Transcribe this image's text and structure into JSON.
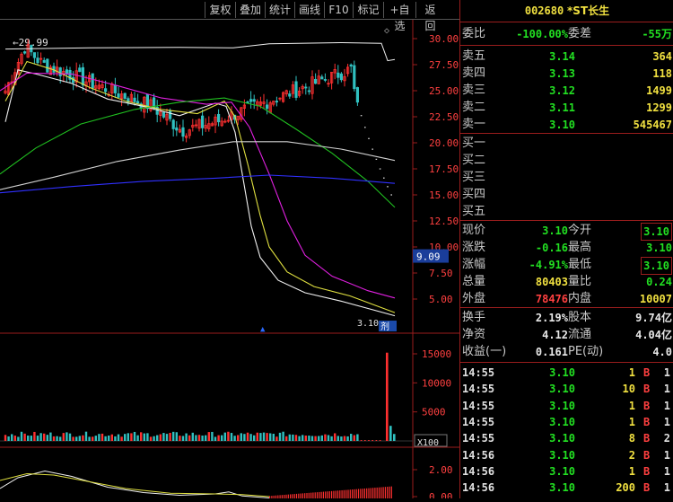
{
  "toolbar": {
    "buttons": [
      "复权",
      "叠加",
      "统计",
      "画线",
      "F10",
      "标记",
      "+自选",
      "返回"
    ]
  },
  "chart": {
    "max_label": "29.99",
    "price_axis": [
      "30.00",
      "27.50",
      "25.00",
      "22.50",
      "20.00",
      "17.50",
      "15.00",
      "12.50",
      "10.00",
      "7.50",
      "5.00"
    ],
    "current_tag": "9.09",
    "last_label": "3.10",
    "last_suffix": "剂",
    "volume_axis": [
      "15000",
      "10000",
      "5000"
    ],
    "volume_unit": "X100",
    "ind_axis": [
      "2.00",
      "0.00"
    ],
    "colors": {
      "up": "#ff3030",
      "down": "#30c0c0",
      "ma5": "#f0f0f0",
      "ma10": "#e0e040",
      "ma20": "#e020e0",
      "ma60": "#20c020",
      "ma120": "#d0d0d0",
      "ma250": "#3030ff",
      "axis": "#9a1d1d",
      "label": "#ff4040"
    }
  },
  "panel": {
    "code": "002680",
    "name": "*ST长生",
    "weibi_label": "委比",
    "weibi_value": "-100.00%",
    "weicha_label": "委差",
    "weicha_value": "-55万",
    "sells": [
      {
        "label": "卖五",
        "price": "3.14",
        "vol": "364"
      },
      {
        "label": "卖四",
        "price": "3.13",
        "vol": "118"
      },
      {
        "label": "卖三",
        "price": "3.12",
        "vol": "1499"
      },
      {
        "label": "卖二",
        "price": "3.11",
        "vol": "1299"
      },
      {
        "label": "卖一",
        "price": "3.10",
        "vol": "545467"
      }
    ],
    "buys": [
      "买一",
      "买二",
      "买三",
      "买四",
      "买五"
    ],
    "quote": [
      {
        "l1": "现价",
        "v1": "3.10",
        "l2": "今开",
        "v2": "3.10"
      },
      {
        "l1": "涨跌",
        "v1": "-0.16",
        "l2": "最高",
        "v2": "3.10"
      },
      {
        "l1": "涨幅",
        "v1": "-4.91%",
        "l2": "最低",
        "v2": "3.10"
      },
      {
        "l1": "总量",
        "v1": "80403",
        "l2": "量比",
        "v2": "0.24"
      },
      {
        "l1": "外盘",
        "v1": "78476",
        "l2": "内盘",
        "v2": "10007"
      }
    ],
    "fund": [
      {
        "l1": "换手",
        "v1": "2.19%",
        "l2": "股本",
        "v2": "9.74亿"
      },
      {
        "l1": "净资",
        "v1": "4.12",
        "l2": "流通",
        "v2": "4.04亿"
      },
      {
        "l1": "收益(一)",
        "v1": "0.161",
        "l2": "PE(动)",
        "v2": "4.0"
      }
    ],
    "ticks": [
      {
        "time": "14:55",
        "price": "3.10",
        "vol": "1",
        "bs": "B",
        "n": "1"
      },
      {
        "time": "14:55",
        "price": "3.10",
        "vol": "10",
        "bs": "B",
        "n": "1"
      },
      {
        "time": "14:55",
        "price": "3.10",
        "vol": "1",
        "bs": "B",
        "n": "1"
      },
      {
        "time": "14:55",
        "price": "3.10",
        "vol": "1",
        "bs": "B",
        "n": "1"
      },
      {
        "time": "14:55",
        "price": "3.10",
        "vol": "8",
        "bs": "B",
        "n": "2"
      },
      {
        "time": "14:56",
        "price": "3.10",
        "vol": "2",
        "bs": "B",
        "n": "1"
      },
      {
        "time": "14:56",
        "price": "3.10",
        "vol": "1",
        "bs": "B",
        "n": "1"
      },
      {
        "time": "14:56",
        "price": "3.10",
        "vol": "200",
        "bs": "B",
        "n": "1"
      }
    ]
  }
}
